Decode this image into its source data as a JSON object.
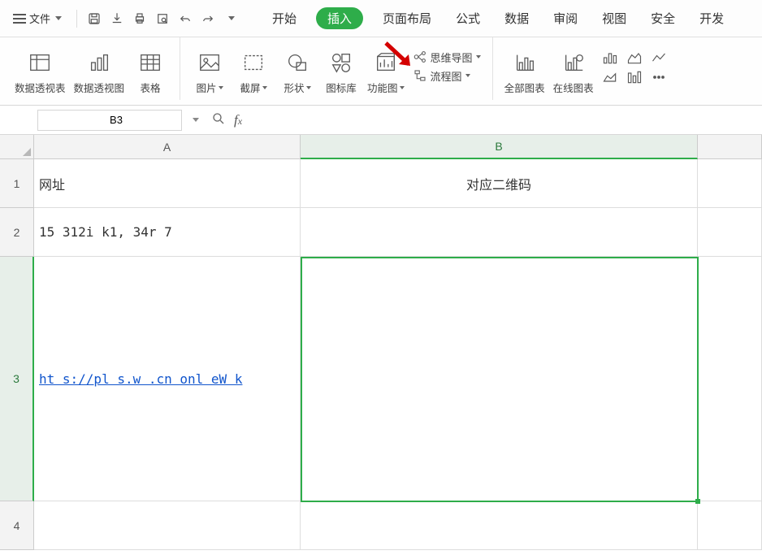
{
  "topbar": {
    "file_label": "文件"
  },
  "tabs": {
    "start": "开始",
    "insert": "插入",
    "page_layout": "页面布局",
    "formula": "公式",
    "data": "数据",
    "review": "审阅",
    "view": "视图",
    "security": "安全",
    "dev": "开发"
  },
  "ribbon": {
    "pivot_table": "数据透视表",
    "pivot_chart": "数据透视图",
    "table": "表格",
    "picture": "图片",
    "screenshot": "截屏",
    "shapes": "形状",
    "icons": "图标库",
    "smart_chart": "功能图",
    "mindmap": "思维导图",
    "flowchart": "流程图",
    "all_charts": "全部图表",
    "online_chart": "在线图表"
  },
  "namebox": {
    "value": "B3"
  },
  "headers": {
    "A": "A",
    "B": "B"
  },
  "rows": {
    "r1": "1",
    "r2": "2",
    "r3": "3",
    "r4": "4"
  },
  "cells": {
    "A1": "网址",
    "B1": "对应二维码",
    "A2": "15  312i   k1,  34r  7",
    "A3": "ht   s://pl  s.w   .cn  onl   eW   k"
  }
}
